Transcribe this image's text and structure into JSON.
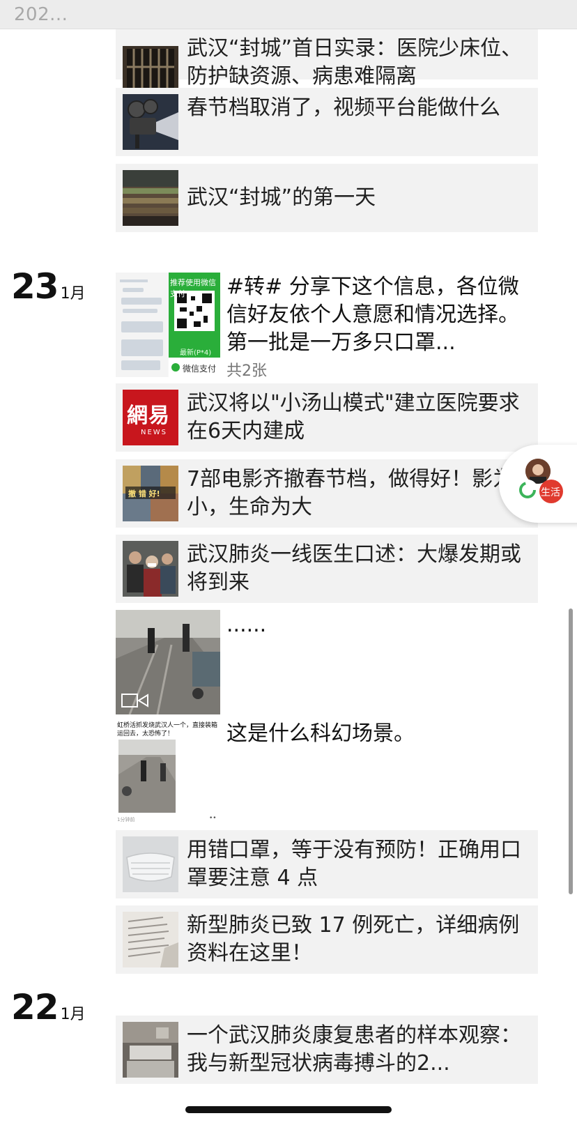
{
  "header": {
    "year_label": "202..."
  },
  "items_top": [
    {
      "title": "武汉“封城”首日实录：医院少床位、防护缺资源、病患难隔离",
      "thumb": "barred-window-photo"
    },
    {
      "title": "春节档取消了，视频平台能做什么",
      "thumb": "film-projector-photo"
    },
    {
      "title": "武汉“封城”的第一天",
      "thumb": "market-shelves-photo"
    }
  ],
  "day_23": {
    "day": "23",
    "month": "1月",
    "post_text": "#转# 分享下这个信息，各位微信好友依个人意愿和情况选择。第一批是一万多只口罩...",
    "post_meta": "共2张",
    "image_label_qr": "推荐使用微信支付",
    "image_label_qr_sub": "最新(P*4)",
    "image_label_pay": "微信支付",
    "links": [
      {
        "title": "武汉将以\"小汤山模式\"建立医院要求在6天内建成",
        "thumb": "netease-news-logo",
        "logo_text": "網易",
        "logo_sub": "NEWS"
      },
      {
        "title": "7部电影齐撤春节档，做得好！影为小，生命为大",
        "thumb": "movie-poster-collage",
        "poster_text": "撤 错 好!"
      },
      {
        "title": "武汉肺炎一线医生口述：大爆发期或将到来",
        "thumb": "hospital-crowd-photo"
      }
    ],
    "video_post_text": "......",
    "screenshot_post_text": "这是什么科幻场景。",
    "screenshot_caption": "虹桥活抓发烧武汉人一个，直接装箱运回去，太恐怖了！",
    "screenshot_footer_left": "1分钟前",
    "screenshot_footer_right": "••",
    "links2": [
      {
        "title": "用错口罩，等于没有预防！正确用口罩要注意 4 点",
        "thumb": "mask-photo"
      },
      {
        "title": "新型肺炎已致 17 例死亡，详细病例资料在这里！",
        "thumb": "document-photo"
      }
    ]
  },
  "day_22": {
    "day": "22",
    "month": "1月",
    "links": [
      {
        "title": "一个武汉肺炎康复患者的样本观察：我与新型冠状病毒搏斗的2...",
        "thumb": "hospital-ward-photo"
      }
    ]
  },
  "floating_widget": {
    "label": "生活"
  }
}
